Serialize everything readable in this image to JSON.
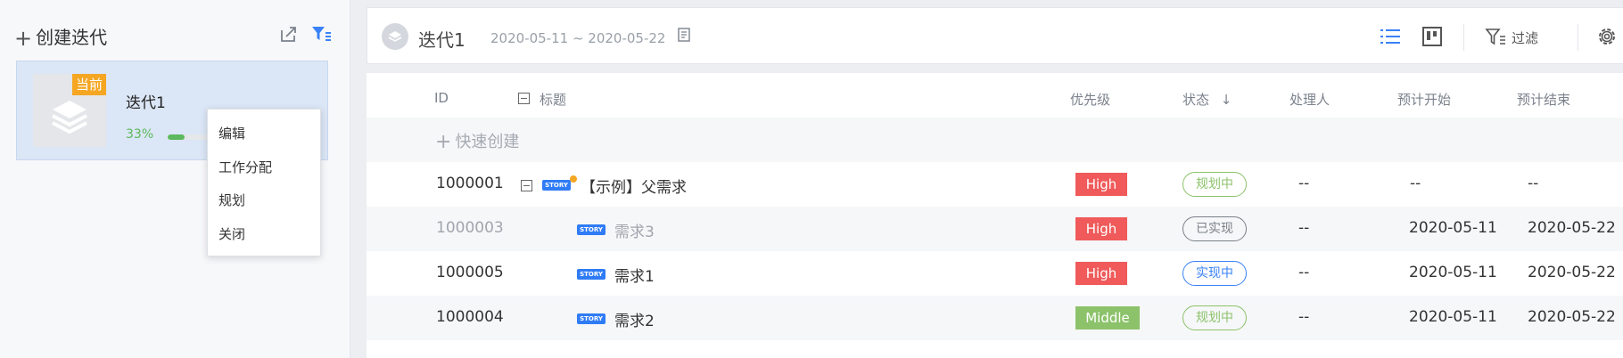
{
  "sidebar": {
    "create_label": "创建迭代",
    "iteration": {
      "badge": "当前",
      "name": "迭代1",
      "progress_text": "33%",
      "progress": 0.33
    },
    "context_menu": [
      "编辑",
      "工作分配",
      "规划",
      "关闭"
    ]
  },
  "header": {
    "title": "迭代1",
    "date_range": "2020-05-11 ~ 2020-05-22",
    "filter_label": "过滤"
  },
  "table": {
    "columns": {
      "id": "ID",
      "title": "标题",
      "priority": "优先级",
      "status": "状态",
      "status_sort": "↓",
      "assignee": "处理人",
      "plan_start": "预计开始",
      "plan_end": "预计结束"
    },
    "quick_create": "快速创建",
    "story_tag": "STORY",
    "rows": [
      {
        "id": "1000001",
        "title": "【示例】父需求",
        "priority": "High",
        "status": "规划中",
        "assignee": "--",
        "start": "--",
        "end": "--"
      },
      {
        "id": "1000003",
        "title": "需求3",
        "priority": "High",
        "status": "已实现",
        "assignee": "--",
        "start": "2020-05-11",
        "end": "2020-05-22"
      },
      {
        "id": "1000005",
        "title": "需求1",
        "priority": "High",
        "status": "实现中",
        "assignee": "--",
        "start": "2020-05-11",
        "end": "2020-05-22"
      },
      {
        "id": "1000004",
        "title": "需求2",
        "priority": "Middle",
        "status": "规划中",
        "assignee": "--",
        "start": "2020-05-11",
        "end": "2020-05-22"
      }
    ]
  },
  "colors": {
    "priority_high": "#f05a5a",
    "priority_middle": "#8cc26a",
    "status_planning": "#8cc26a",
    "status_done": "#7a8088",
    "status_in_progress": "#3a82f6",
    "accent_blue": "#3a82f6",
    "badge_orange": "#f5a623"
  }
}
